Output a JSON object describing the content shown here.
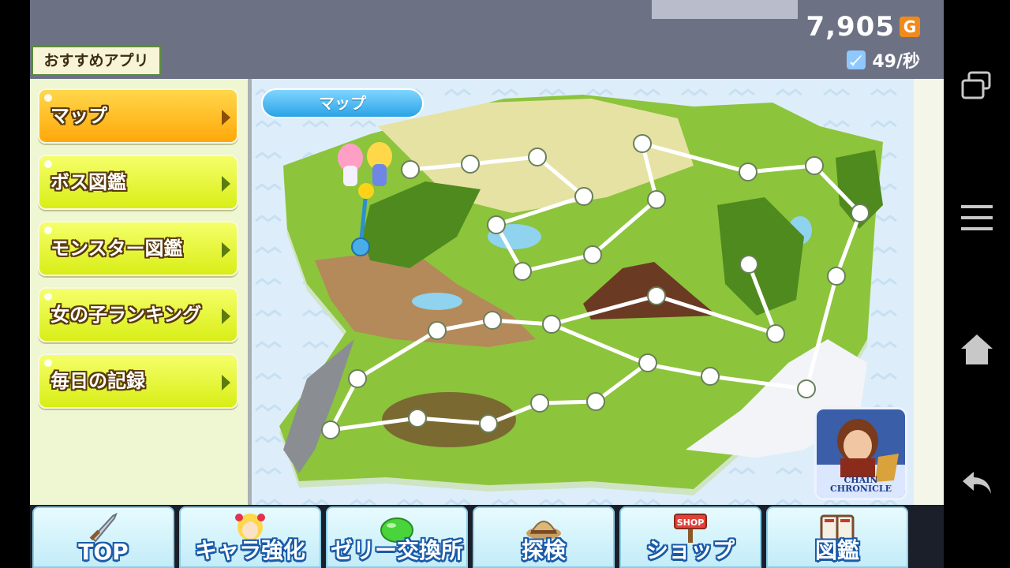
{
  "header": {
    "gold_value": "7,905",
    "gold_icon_letter": "G",
    "dps_value": "49/秒",
    "recommended_apps": "おすすめアプリ"
  },
  "sidebar": {
    "items": [
      {
        "label": "マップ",
        "active": true
      },
      {
        "label": "ボス図鑑",
        "active": false
      },
      {
        "label": "モンスター図鑑",
        "active": false
      },
      {
        "label": "女の子ランキング",
        "active": false
      },
      {
        "label": "毎日の記録",
        "active": false
      }
    ]
  },
  "map": {
    "tab_label": "マップ",
    "cleared_stages": 1,
    "colors": {
      "cleared": "#48aee8",
      "uncleared": "#ffffff",
      "path": "#ffffff"
    }
  },
  "promo": {
    "title_line1": "CHAIN",
    "title_line2": "CHRONICLE"
  },
  "bottom_nav": {
    "items": [
      {
        "label": "TOP",
        "icon": "sword-icon"
      },
      {
        "label": "キャラ強化",
        "icon": "girl-character-icon"
      },
      {
        "label": "ゼリー交換所",
        "icon": "green-jelly-icon"
      },
      {
        "label": "探検",
        "icon": "explorer-hat-icon"
      },
      {
        "label": "ショップ",
        "icon": "shop-sign-icon",
        "sign_text": "SHOP"
      },
      {
        "label": "図鑑",
        "icon": "book-icon"
      }
    ]
  },
  "system_nav": [
    "recent-apps-icon",
    "menu-icon",
    "home-icon",
    "back-icon"
  ]
}
